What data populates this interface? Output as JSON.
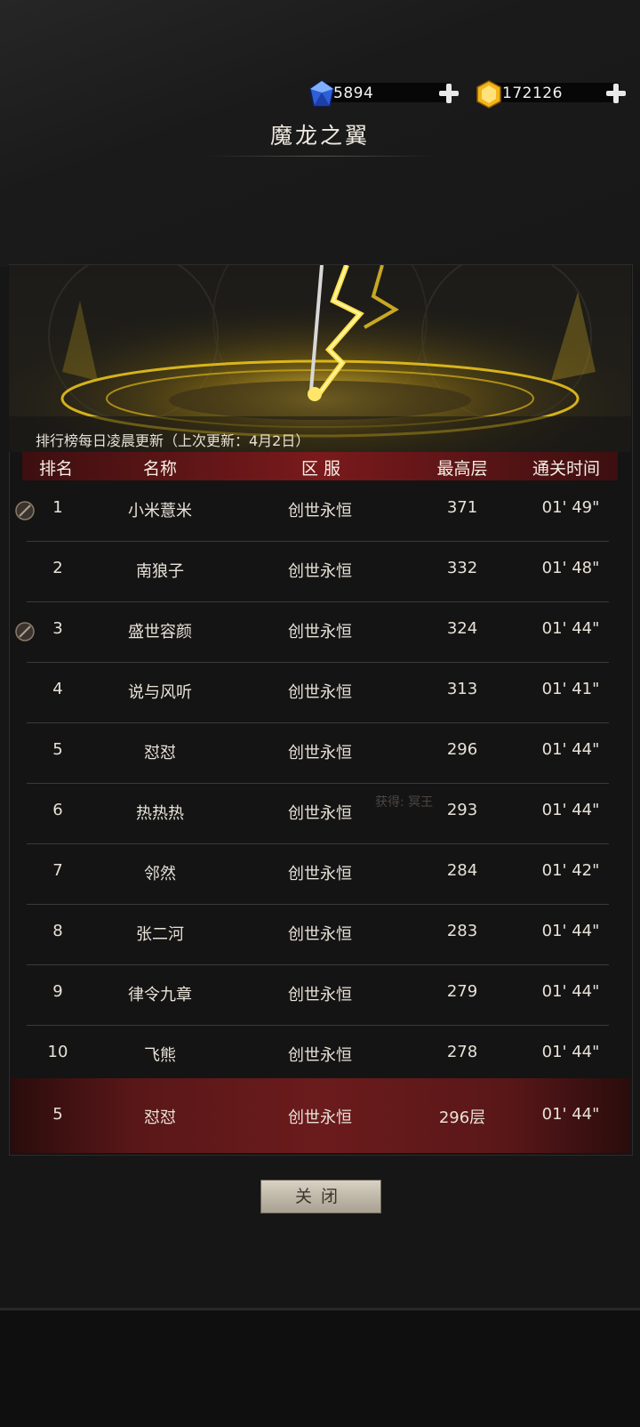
{
  "currency": {
    "diamond": {
      "value": "5894",
      "icon": "blue-diamond-icon"
    },
    "gold": {
      "value": "172126",
      "icon": "gold-gem-icon"
    }
  },
  "title": "魔龙之翼",
  "notice": "排行榜每日凌晨更新（上次更新：4月2日）",
  "columns": {
    "rank": "排名",
    "name": "名称",
    "server": "区 服",
    "floor": "最高层",
    "time": "通关时间"
  },
  "rows": [
    {
      "rank": "1",
      "name": "小米薏米",
      "server": "创世永恒",
      "floor": "371",
      "time": "01' 49\"",
      "medal": true
    },
    {
      "rank": "2",
      "name": "南狼子",
      "server": "创世永恒",
      "floor": "332",
      "time": "01' 48\"",
      "medal": false
    },
    {
      "rank": "3",
      "name": "盛世容颜",
      "server": "创世永恒",
      "floor": "324",
      "time": "01' 44\"",
      "medal": true
    },
    {
      "rank": "4",
      "name": "说与风听",
      "server": "创世永恒",
      "floor": "313",
      "time": "01' 41\"",
      "medal": false
    },
    {
      "rank": "5",
      "name": "怼怼",
      "server": "创世永恒",
      "floor": "296",
      "time": "01' 44\"",
      "medal": false
    },
    {
      "rank": "6",
      "name": "热热热",
      "server": "创世永恒",
      "floor": "293",
      "time": "01' 44\"",
      "medal": false
    },
    {
      "rank": "7",
      "name": "邻然",
      "server": "创世永恒",
      "floor": "284",
      "time": "01' 42\"",
      "medal": false
    },
    {
      "rank": "8",
      "name": "张二河",
      "server": "创世永恒",
      "floor": "283",
      "time": "01' 44\"",
      "medal": false
    },
    {
      "rank": "9",
      "name": "律令九章",
      "server": "创世永恒",
      "floor": "279",
      "time": "01' 44\"",
      "medal": false
    },
    {
      "rank": "10",
      "name": "飞熊",
      "server": "创世永恒",
      "floor": "278",
      "time": "01' 44\"",
      "medal": false
    }
  ],
  "watermark": "获得: 冥王",
  "my_rank": {
    "rank": "5",
    "name": "怼怼",
    "server": "创世永恒",
    "floor": "296层",
    "time": "01' 44\""
  },
  "close_label": "关闭",
  "colors": {
    "header_red": "#7a1a1c",
    "highlight_red": "#6b1b1c",
    "gold_glow": "#f2c91a"
  }
}
